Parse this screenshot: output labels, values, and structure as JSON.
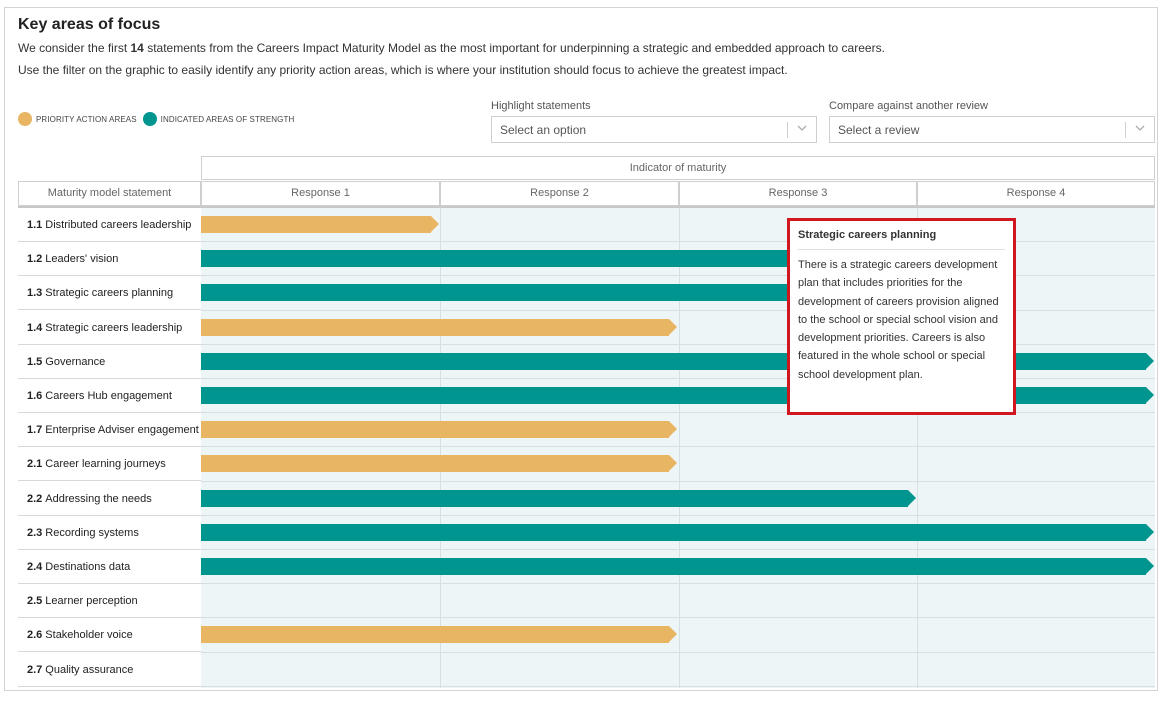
{
  "header": {
    "title": "Key areas of focus",
    "desc1_pre": "We consider the first",
    "desc1_bold": "14",
    "desc1_post": "statements from the Careers Impact Maturity Model as the most important for underpinning a strategic and embedded approach to careers.",
    "desc2": "Use the filter on the graphic to easily identify any priority action areas, which is where your institution should focus to achieve the greatest impact."
  },
  "legend": {
    "priority_label": "Priority action areas",
    "strength_label": "Indicated areas of strength",
    "priority_color": "#e8b563",
    "strength_color": "#00968f"
  },
  "filters": {
    "highlight": {
      "label": "Highlight statements",
      "placeholder": "Select an option"
    },
    "compare": {
      "label": "Compare against another review",
      "placeholder": "Select a review"
    }
  },
  "table": {
    "indicator_header": "Indicator of maturity",
    "statement_header": "Maturity model statement",
    "responses": [
      "Response 1",
      "Response 2",
      "Response 3",
      "Response 4"
    ],
    "rows": [
      {
        "num": "1.1",
        "label": "Distributed careers leadership",
        "level": 1,
        "type": "priority"
      },
      {
        "num": "1.2",
        "label": "Leaders' vision",
        "level": 3,
        "type": "strength"
      },
      {
        "num": "1.3",
        "label": "Strategic careers planning",
        "level": 3,
        "type": "strength"
      },
      {
        "num": "1.4",
        "label": "Strategic careers leadership",
        "level": 2,
        "type": "priority"
      },
      {
        "num": "1.5",
        "label": "Governance",
        "level": 4,
        "type": "strength"
      },
      {
        "num": "1.6",
        "label": "Careers Hub engagement",
        "level": 4,
        "type": "strength"
      },
      {
        "num": "1.7",
        "label": "Enterprise Adviser engagement",
        "level": 2,
        "type": "priority"
      },
      {
        "num": "2.1",
        "label": "Career learning journeys",
        "level": 2,
        "type": "priority"
      },
      {
        "num": "2.2",
        "label": "Addressing the needs",
        "level": 3,
        "type": "strength"
      },
      {
        "num": "2.3",
        "label": "Recording systems",
        "level": 4,
        "type": "strength"
      },
      {
        "num": "2.4",
        "label": "Destinations data",
        "level": 4,
        "type": "strength"
      },
      {
        "num": "2.5",
        "label": "Learner perception",
        "level": 0,
        "type": "none"
      },
      {
        "num": "2.6",
        "label": "Stakeholder voice",
        "level": 2,
        "type": "priority"
      },
      {
        "num": "2.7",
        "label": "Quality assurance",
        "level": 0,
        "type": "none"
      }
    ]
  },
  "tooltip": {
    "title": "Strategic careers planning",
    "body": "There is a strategic careers development plan that includes priorities for the development of careers provision aligned to the school or special school vision and development priorities. Careers is also featured in the whole school or special school development plan."
  }
}
